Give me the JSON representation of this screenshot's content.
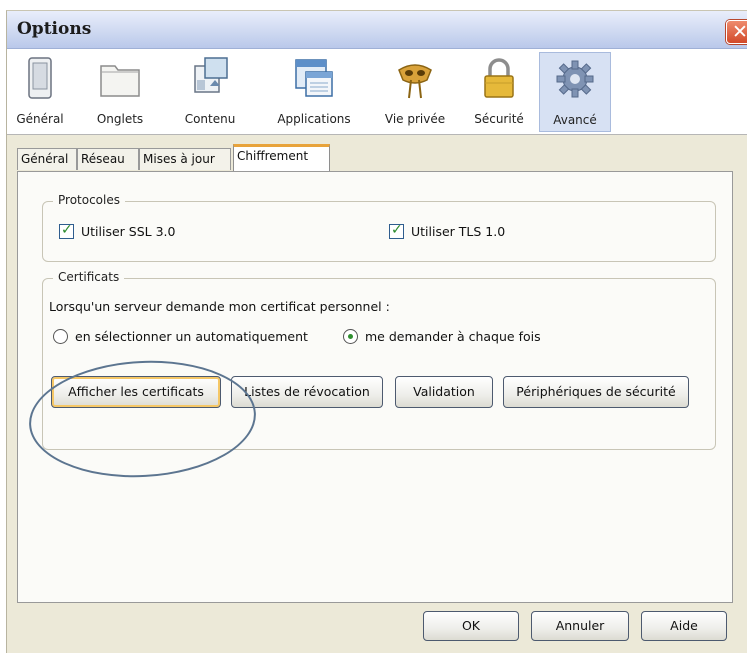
{
  "window": {
    "title": "Options"
  },
  "toolbar": {
    "items": [
      {
        "label": "Général",
        "icon": "general-icon"
      },
      {
        "label": "Onglets",
        "icon": "tabs-icon"
      },
      {
        "label": "Contenu",
        "icon": "content-icon"
      },
      {
        "label": "Applications",
        "icon": "applications-icon"
      },
      {
        "label": "Vie privée",
        "icon": "privacy-mask-icon"
      },
      {
        "label": "Sécurité",
        "icon": "padlock-icon"
      },
      {
        "label": "Avancé",
        "icon": "gear-icon",
        "selected": true
      }
    ]
  },
  "subtabs": [
    {
      "label": "Général"
    },
    {
      "label": "Réseau"
    },
    {
      "label": "Mises à jour"
    },
    {
      "label": "Chiffrement",
      "selected": true
    }
  ],
  "protocols": {
    "legend": "Protocoles",
    "ssl_label": "Utiliser SSL 3.0",
    "ssl_checked": true,
    "tls_label": "Utiliser TLS 1.0",
    "tls_checked": true
  },
  "certificates": {
    "legend": "Certificats",
    "prompt": "Lorsqu'un serveur demande mon certificat personnel :",
    "option_auto": "en sélectionner un automatiquement",
    "option_ask": "me demander à chaque fois",
    "selected_option": "me demander à chaque fois",
    "buttons": {
      "view": "Afficher les certificats",
      "revocation": "Listes de révocation",
      "validation": "Validation",
      "devices": "Périphériques de sécurité"
    }
  },
  "dialog_buttons": {
    "ok": "OK",
    "cancel": "Annuler",
    "help": "Aide"
  },
  "colors": {
    "active_tab_accent": "#e8a33b",
    "checkmark": "#2a8a2a",
    "annotation_circle": "#5c7590",
    "close_button": "#d2492a"
  }
}
